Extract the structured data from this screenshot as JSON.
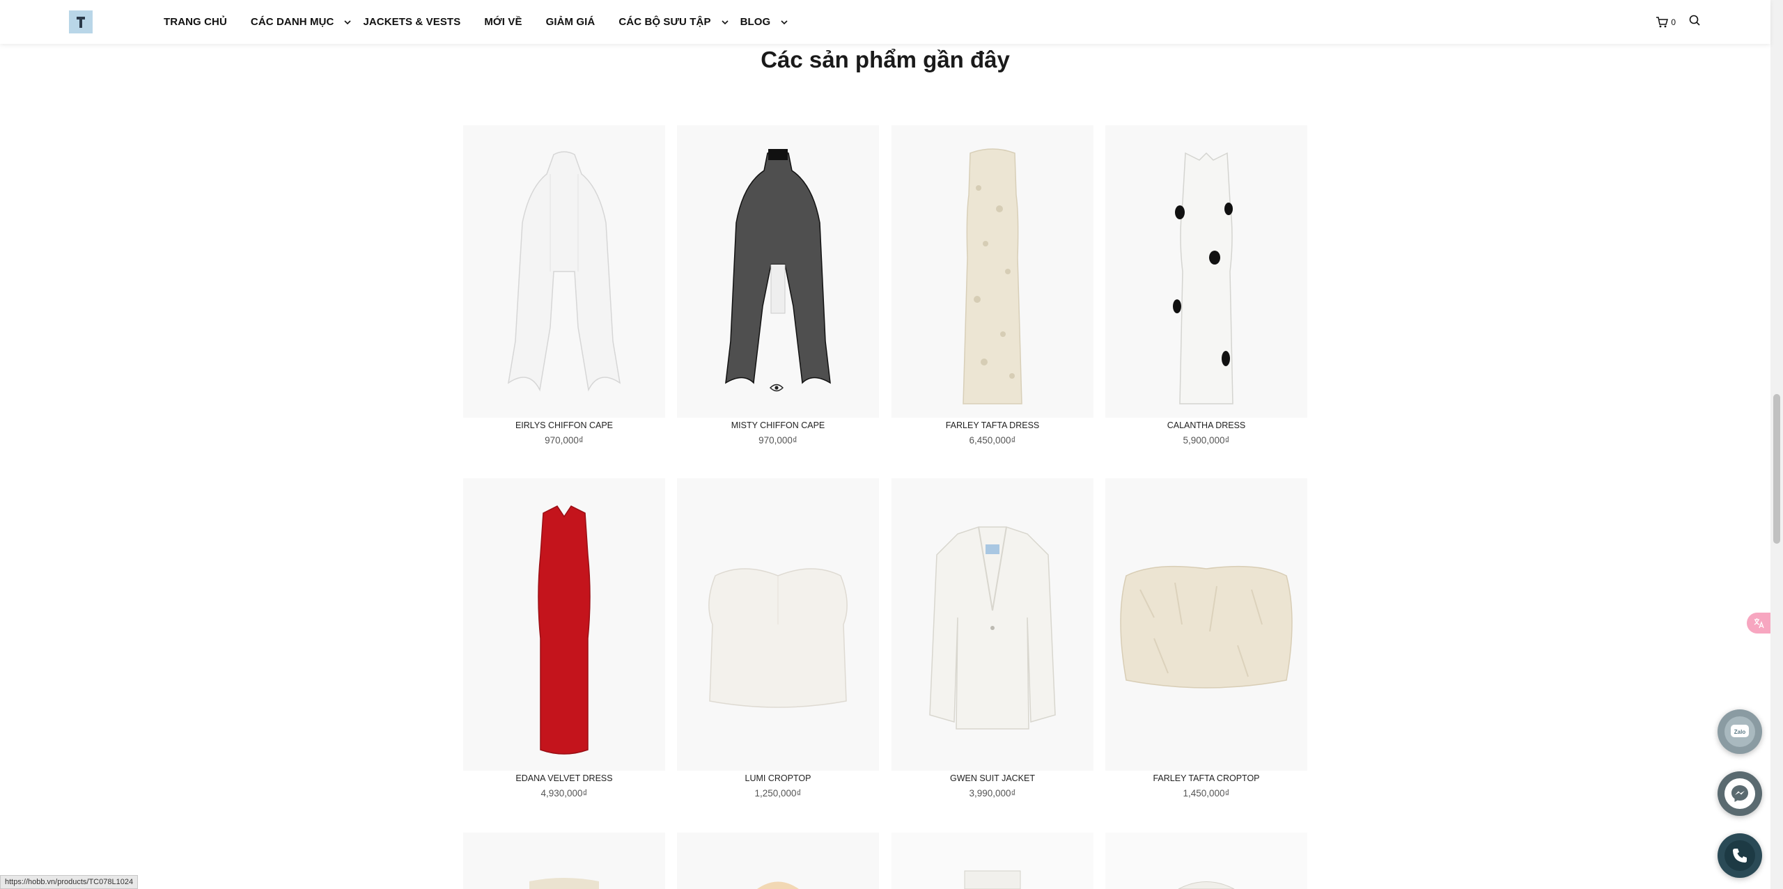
{
  "header": {
    "nav": [
      {
        "label": "TRANG CHỦ",
        "has_dropdown": false
      },
      {
        "label": "CÁC DANH MỤC",
        "has_dropdown": true
      },
      {
        "label": "JACKETS & VESTS",
        "has_dropdown": false
      },
      {
        "label": "MỚI VỀ",
        "has_dropdown": false
      },
      {
        "label": "GIẢM GIÁ",
        "has_dropdown": false
      },
      {
        "label": "CÁC BỘ SƯU TẬP",
        "has_dropdown": true
      },
      {
        "label": "BLOG",
        "has_dropdown": true
      }
    ],
    "cart_count": "0"
  },
  "section": {
    "title": "Các sản phẩm gần đây"
  },
  "products": [
    {
      "name": "EIRLYS CHIFFON CAPE",
      "price": "970,000₫"
    },
    {
      "name": "MISTY CHIFFON CAPE",
      "price": "970,000₫"
    },
    {
      "name": "FARLEY TAFTA DRESS",
      "price": "6,450,000₫"
    },
    {
      "name": "CALANTHA DRESS",
      "price": "5,900,000₫"
    },
    {
      "name": "EDANA VELVET DRESS",
      "price": "4,930,000₫"
    },
    {
      "name": "LUMI CROPTOP",
      "price": "1,250,000₫"
    },
    {
      "name": "GWEN SUIT JACKET",
      "price": "3,990,000₫"
    },
    {
      "name": "FARLEY TAFTA CROPTOP",
      "price": "1,450,000₫"
    }
  ],
  "status_bar": {
    "url": "https://hobb.vn/products/TC078L1024"
  },
  "colors": {
    "accent": "#3c6e7a",
    "red_dress": "#c4141c"
  }
}
